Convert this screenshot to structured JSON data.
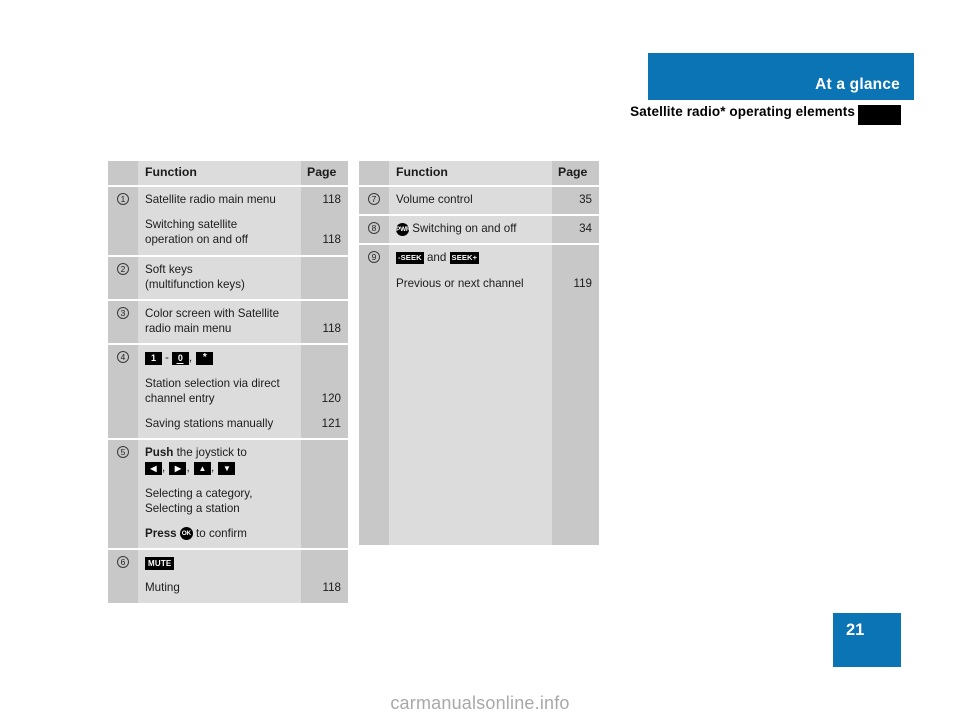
{
  "header": {
    "chapter_title": "At a glance",
    "subtitle": "Satellite radio* operating elements",
    "accent_color": "#0b74b4"
  },
  "tables": {
    "left": {
      "columns": {
        "function": "Function",
        "page": "Page"
      },
      "rows": [
        {
          "num": "1",
          "lines": [
            {
              "text": "Satellite radio main menu",
              "page": "118"
            },
            {
              "text": "Switching satellite",
              "page": "",
              "gap": true
            },
            {
              "text": "operation on and off",
              "page": "118"
            }
          ]
        },
        {
          "num": "2",
          "lines": [
            {
              "text": "Soft keys",
              "page": ""
            },
            {
              "text": "(multifunction keys)",
              "page": ""
            }
          ]
        },
        {
          "num": "3",
          "lines": [
            {
              "text": "Color screen with Satellite",
              "page": ""
            },
            {
              "text": "radio main menu",
              "page": "118"
            }
          ]
        },
        {
          "num": "4",
          "keys": [
            "1",
            "0",
            "*"
          ],
          "lines": [
            {
              "text": "Station selection via direct",
              "page": ""
            },
            {
              "text": "channel entry",
              "page": "120"
            },
            {
              "text": "Saving stations manually",
              "page": "121",
              "gap": true
            }
          ]
        },
        {
          "num": "5",
          "push_prefix": "Push",
          "push_suffix": " the joystick to",
          "arrows": [
            "left",
            "right",
            "up",
            "down"
          ],
          "lines": [
            {
              "text": "Selecting a category,",
              "page": ""
            },
            {
              "text": "Selecting a station",
              "page": ""
            }
          ],
          "press_prefix": "Press",
          "press_key": "OK",
          "press_suffix": " to confirm"
        },
        {
          "num": "6",
          "mute_key": "MUTE",
          "lines": [
            {
              "text": "Muting",
              "page": "118"
            }
          ]
        }
      ]
    },
    "right": {
      "columns": {
        "function": "Function",
        "page": "Page"
      },
      "rows": [
        {
          "num": "7",
          "lines": [
            {
              "text": "Volume control",
              "page": "35"
            }
          ]
        },
        {
          "num": "8",
          "pwr_key": "PWR",
          "lines": [
            {
              "text": "Switching on and off",
              "page": "34"
            }
          ]
        },
        {
          "num": "9",
          "seek_left": "-SEEK",
          "seek_and": "and",
          "seek_right": "SEEK+",
          "lines": [
            {
              "text": "Previous or next channel",
              "page": "119",
              "gap": true
            }
          ]
        }
      ]
    }
  },
  "footer": {
    "page_number": "21",
    "watermark": "carmanualsonline.info"
  }
}
